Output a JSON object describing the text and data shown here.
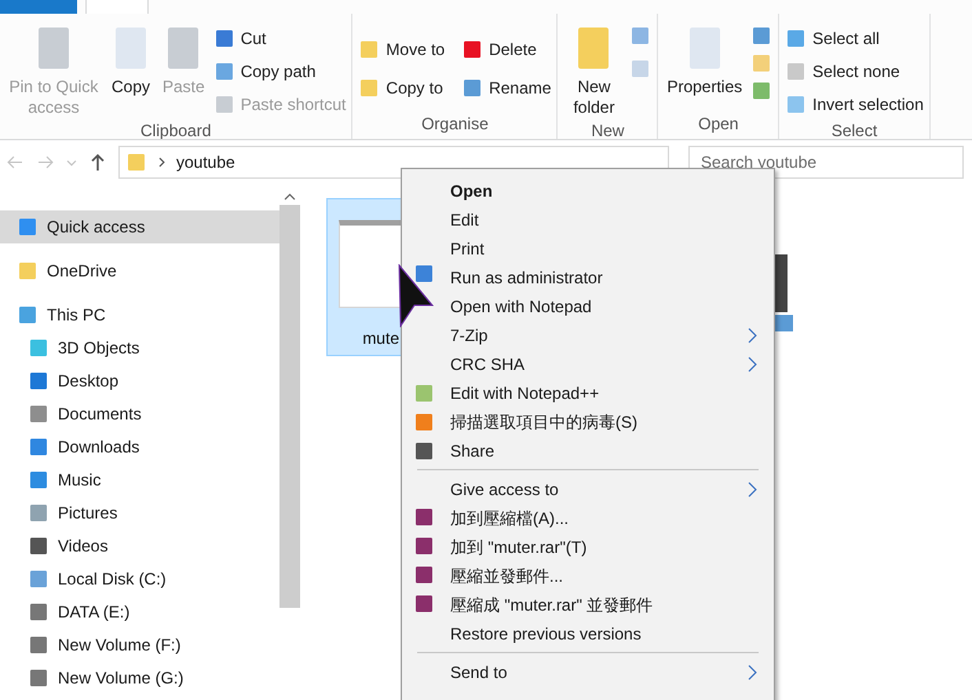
{
  "ribbon_groups": [
    {
      "label": "Clipboard",
      "large": [
        {
          "label": "Pin to Quick access",
          "disabled": true
        },
        {
          "label": "Copy",
          "disabled": false
        },
        {
          "label": "Paste",
          "disabled": true
        }
      ],
      "small": [
        {
          "label": "Cut",
          "disabled": false
        },
        {
          "label": "Copy path",
          "disabled": false
        },
        {
          "label": "Paste shortcut",
          "disabled": true
        }
      ]
    },
    {
      "label": "Organise",
      "small": [
        {
          "label": "Move to",
          "disabled": false
        },
        {
          "label": "Copy to",
          "disabled": false
        },
        {
          "label": "Delete",
          "disabled": false
        },
        {
          "label": "Rename",
          "disabled": false
        }
      ]
    },
    {
      "label": "New",
      "large": [
        {
          "label": "New folder",
          "disabled": false
        }
      ]
    },
    {
      "label": "Open",
      "large": [
        {
          "label": "Properties",
          "disabled": false
        }
      ]
    },
    {
      "label": "Select",
      "small": [
        {
          "label": "Select all",
          "disabled": false
        },
        {
          "label": "Select none",
          "disabled": false
        },
        {
          "label": "Invert selection",
          "disabled": false
        }
      ]
    }
  ],
  "address": {
    "crumb": "youtube"
  },
  "search": {
    "placeholder": "Search youtube"
  },
  "sidebar": {
    "items": [
      {
        "label": "Quick access",
        "selected": true
      },
      {
        "label": "OneDrive",
        "selected": false
      },
      {
        "label": "This PC",
        "selected": false,
        "children": [
          {
            "label": "3D Objects",
            "selected": false
          },
          {
            "label": "Desktop",
            "selected": false
          },
          {
            "label": "Documents",
            "selected": false
          },
          {
            "label": "Downloads",
            "selected": false
          },
          {
            "label": "Music",
            "selected": false
          },
          {
            "label": "Pictures",
            "selected": false
          },
          {
            "label": "Videos",
            "selected": false
          },
          {
            "label": "Local Disk (C:)",
            "selected": false
          },
          {
            "label": "DATA (E:)",
            "selected": false
          },
          {
            "label": "New Volume (F:)",
            "selected": false
          },
          {
            "label": "New Volume (G:)",
            "selected": false
          }
        ]
      }
    ]
  },
  "files": [
    {
      "name": "mute",
      "selected": true
    }
  ],
  "context_menu": [
    {
      "kind": "item",
      "label": "Open",
      "default": true,
      "submenu": false
    },
    {
      "kind": "item",
      "label": "Edit",
      "default": false,
      "submenu": false
    },
    {
      "kind": "item",
      "label": "Print",
      "default": false,
      "submenu": false
    },
    {
      "kind": "item",
      "label": "Run as administrator",
      "default": false,
      "submenu": false
    },
    {
      "kind": "item",
      "label": "Open with Notepad",
      "default": false,
      "submenu": false
    },
    {
      "kind": "item",
      "label": "7-Zip",
      "default": false,
      "submenu": true
    },
    {
      "kind": "item",
      "label": "CRC SHA",
      "default": false,
      "submenu": true
    },
    {
      "kind": "item",
      "label": "Edit with Notepad++",
      "default": false,
      "submenu": false
    },
    {
      "kind": "item",
      "label": "掃描選取項目中的病毒(S)",
      "default": false,
      "submenu": false
    },
    {
      "kind": "item",
      "label": "Share",
      "default": false,
      "submenu": false
    },
    {
      "kind": "separator"
    },
    {
      "kind": "item",
      "label": "Give access to",
      "default": false,
      "submenu": true
    },
    {
      "kind": "item",
      "label": "加到壓縮檔(A)...",
      "default": false,
      "submenu": false
    },
    {
      "kind": "item",
      "label": "加到 \"muter.rar\"(T)",
      "default": false,
      "submenu": false
    },
    {
      "kind": "item",
      "label": "壓縮並發郵件...",
      "default": false,
      "submenu": false
    },
    {
      "kind": "item",
      "label": "壓縮成 \"muter.rar\" 並發郵件",
      "default": false,
      "submenu": false
    },
    {
      "kind": "item",
      "label": "Restore previous versions",
      "default": false,
      "submenu": false
    },
    {
      "kind": "separator"
    },
    {
      "kind": "item",
      "label": "Send to",
      "default": false,
      "submenu": true
    }
  ]
}
